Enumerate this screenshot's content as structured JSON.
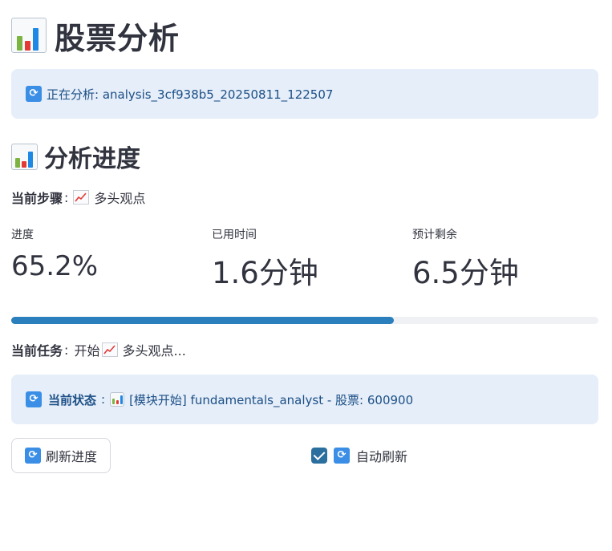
{
  "page": {
    "title": "股票分析",
    "title_icon": "bar-chart-icon"
  },
  "status_banner": {
    "icon": "refresh-icon",
    "text": "正在分析: analysis_3cf938b5_20250811_122507"
  },
  "progress_section": {
    "heading": "分析进度",
    "heading_icon": "bar-chart-icon",
    "current_step_label": "当前步骤",
    "current_step_value": "多头观点",
    "current_step_icon": "trend-chart-icon",
    "metrics": [
      {
        "label": "进度",
        "value": "65.2%"
      },
      {
        "label": "已用时间",
        "value": "1.6分钟"
      },
      {
        "label": "预计剩余",
        "value": "6.5分钟"
      }
    ],
    "progress_fraction": 0.652,
    "progress_color": "#2a7fbc",
    "current_task_label": "当前任务",
    "current_task_prefix": "开始",
    "current_task_icon": "trend-chart-icon",
    "current_task_value": "多头观点..."
  },
  "current_state": {
    "icon": "refresh-icon",
    "label": "当前状态",
    "chart_icon": "bar-chart-icon",
    "text": "[模块开始] fundamentals_analyst - 股票: 600900"
  },
  "controls": {
    "refresh_button_label": "刷新进度",
    "auto_refresh_label": "自动刷新",
    "auto_refresh_checked": true
  },
  "colors": {
    "info_bg": "#e5eef9",
    "info_text": "#1c4f86",
    "accent": "#2a7fbc"
  }
}
